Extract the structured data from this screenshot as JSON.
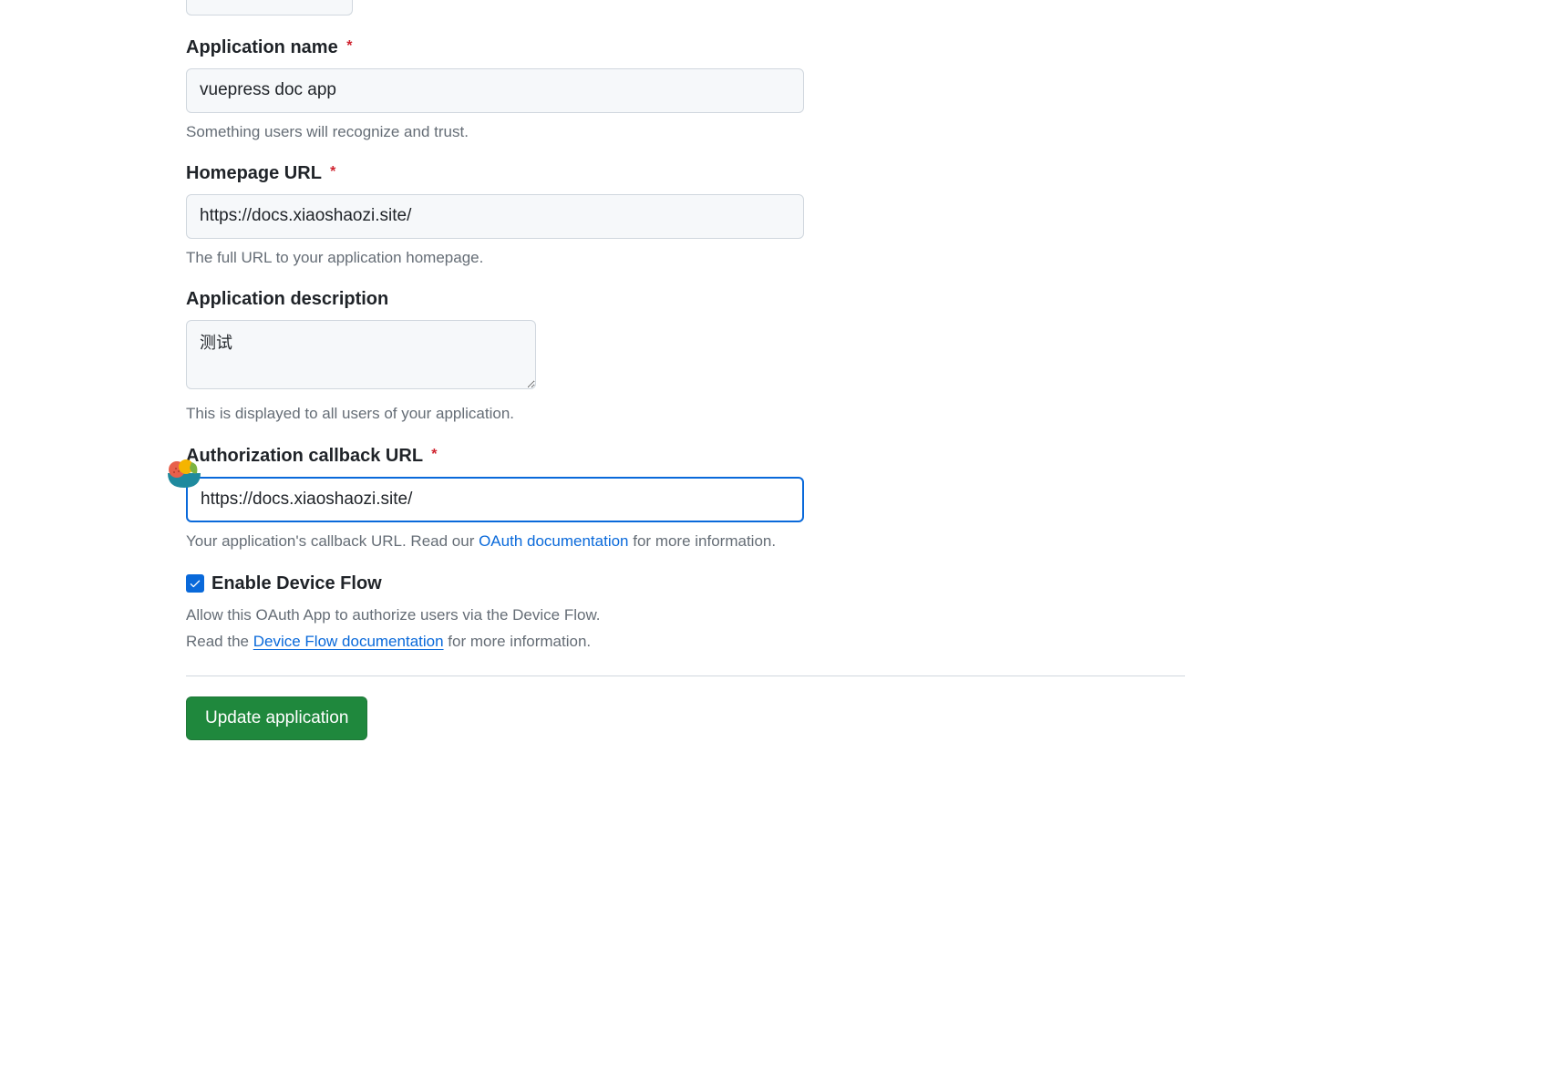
{
  "partial_field": {},
  "app_name": {
    "label": "Application name",
    "required": true,
    "value": "vuepress doc app",
    "help": "Something users will recognize and trust."
  },
  "homepage_url": {
    "label": "Homepage URL",
    "required": true,
    "value": "https://docs.xiaoshaozi.site/",
    "help": "The full URL to your application homepage."
  },
  "app_description": {
    "label": "Application description",
    "required": false,
    "value": "测试",
    "help": "This is displayed to all users of your application."
  },
  "callback_url": {
    "label": "Authorization callback URL",
    "required": true,
    "value": "https://docs.xiaoshaozi.site/",
    "help_prefix": "Your application's callback URL. Read our ",
    "help_link": "OAuth documentation",
    "help_suffix": " for more information."
  },
  "device_flow": {
    "checked": true,
    "label": "Enable Device Flow",
    "help_line1": "Allow this OAuth App to authorize users via the Device Flow.",
    "help_line2_prefix": "Read the ",
    "help_line2_link": "Device Flow documentation",
    "help_line2_suffix": " for more information."
  },
  "submit": {
    "label": "Update application"
  }
}
